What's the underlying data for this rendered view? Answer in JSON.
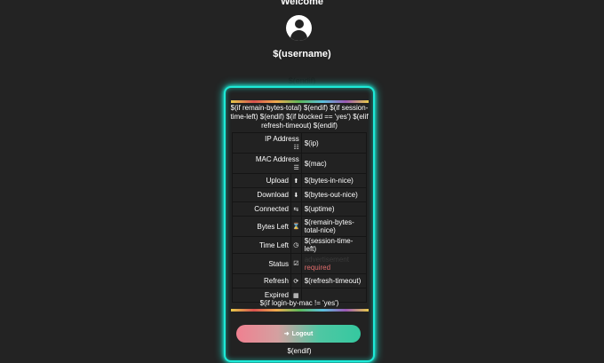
{
  "header": {
    "welcome": "Welcome",
    "username": "$(username)",
    "endif_top": "$(endif)"
  },
  "card": {
    "condition_text": "$(if remain-bytes-total) $(endif) $(if session-time-left) $(endif) $(if blocked == 'yes') $(elif refresh-timeout) $(endif)",
    "login_condition": "$(if login-by-mac != 'yes')",
    "logout_label": "Logout",
    "endif_bottom": "$(endif)",
    "rows": [
      {
        "label": "IP Address",
        "icon": "sitemap-icon",
        "value": "$(ip)"
      },
      {
        "label": "MAC Address",
        "icon": "barcode-icon",
        "value": "$(mac)"
      },
      {
        "label": "Upload",
        "icon": "upload-icon",
        "value": "$(bytes-in-nice)"
      },
      {
        "label": "Download",
        "icon": "download-icon",
        "value": "$(bytes-out-nice)"
      },
      {
        "label": "Connected",
        "icon": "exchange-icon",
        "value": "$(uptime)"
      },
      {
        "label": "Bytes Left",
        "icon": "hourglass-icon",
        "value": "$(remain-bytes-total-nice)"
      },
      {
        "label": "Time Left",
        "icon": "clock-icon",
        "value": "$(session-time-left)"
      },
      {
        "label": "Status",
        "icon": "check-square-icon",
        "value": "advertisement",
        "value2": "required"
      },
      {
        "label": "Refresh",
        "icon": "refresh-icon",
        "value": "$(refresh-timeout)"
      },
      {
        "label": "Expired",
        "icon": "calendar-icon",
        "value": ""
      }
    ]
  },
  "colors": {
    "background": "#232323",
    "glow": "#1de9d6",
    "required": "#e06d6d"
  }
}
